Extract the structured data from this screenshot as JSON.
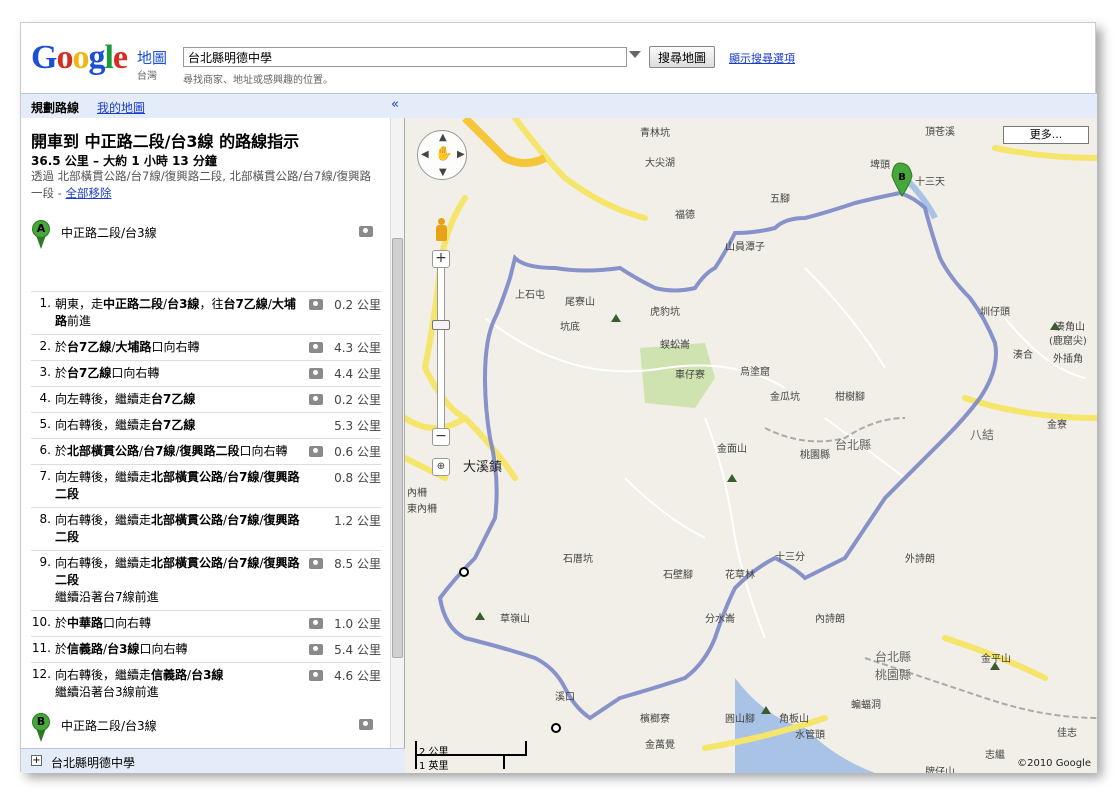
{
  "header": {
    "logo_text": "Google",
    "logo_sub": "地圖",
    "logo_region": "台灣",
    "search_value": "台北縣明德中學",
    "search_button": "搜尋地圖",
    "search_options": "顯示搜尋選項",
    "search_hint": "尋找商家、地址或感興趣的位置。"
  },
  "tabs": {
    "active": "規劃路線",
    "link": "我的地圖",
    "collapse_glyph": "«"
  },
  "directions": {
    "title": "開車到 中正路二段/台3線 的路線指示",
    "summary": "36.5 公里 – 大約 1 小時 13 分鐘",
    "via": "透過 北部橫貫公路/台7線/復興路二段, 北部橫貫公路/台7線/復興路一段 - ",
    "remove_all": "全部移除",
    "start": {
      "marker": "A",
      "label": "中正路二段/台3線"
    },
    "end": {
      "marker": "B",
      "label": "中正路二段/台3線"
    },
    "steps": [
      {
        "num": "1.",
        "text_html": "朝東，走<b>中正路二段</b>/<b>台3線</b>，往<b>台7乙線</b>/<b>大埔路</b>前進",
        "sub": "",
        "dist": "0.2 公里",
        "cam": true
      },
      {
        "num": "2.",
        "text_html": "於<b>台7乙線</b>/<b>大埔路</b>口向右轉",
        "sub": "",
        "dist": "4.3 公里",
        "cam": true
      },
      {
        "num": "3.",
        "text_html": "於<b>台7乙線</b>口向右轉",
        "sub": "",
        "dist": "4.4 公里",
        "cam": true
      },
      {
        "num": "4.",
        "text_html": "向左轉後，繼續走<b>台7乙線</b>",
        "sub": "",
        "dist": "0.2 公里",
        "cam": true
      },
      {
        "num": "5.",
        "text_html": "向右轉後，繼續走<b>台7乙線</b>",
        "sub": "",
        "dist": "5.3 公里",
        "cam": false
      },
      {
        "num": "6.",
        "text_html": "於<b>北部橫貫公路</b>/<b>台7線</b>/<b>復興路二段</b>口向右轉",
        "sub": "",
        "dist": "0.6 公里",
        "cam": true
      },
      {
        "num": "7.",
        "text_html": "向左轉後，繼續走<b>北部橫貫公路</b>/<b>台7線</b>/<b>復興路二段</b>",
        "sub": "",
        "dist": "0.8 公里",
        "cam": false
      },
      {
        "num": "8.",
        "text_html": "向右轉後，繼續走<b>北部橫貫公路</b>/<b>台7線</b>/<b>復興路二段</b>",
        "sub": "",
        "dist": "1.2 公里",
        "cam": false
      },
      {
        "num": "9.",
        "text_html": "向右轉後，繼續走<b>北部橫貫公路</b>/<b>台7線</b>/<b>復興路二段</b>",
        "sub": "繼續沿著台7線前進",
        "dist": "8.5 公里",
        "cam": true
      },
      {
        "num": "10.",
        "text_html": "於<b>中華路</b>口向右轉",
        "sub": "",
        "dist": "1.0 公里",
        "cam": true
      },
      {
        "num": "11.",
        "text_html": "於<b>信義路</b>/<b>台3線</b>口向右轉",
        "sub": "",
        "dist": "5.4 公里",
        "cam": true
      },
      {
        "num": "12.",
        "text_html": "向右轉後，繼續走<b>信義路</b>/<b>台3線</b>",
        "sub": "繼續沿著台3線前進",
        "dist": "4.6 公里",
        "cam": true
      }
    ]
  },
  "bottom_bar": {
    "label": "台北縣明德中學"
  },
  "map": {
    "more_button": "更多...",
    "copyright": "©2010 Google",
    "scale_km": "2 公里",
    "scale_mi": "1 英里",
    "labels": [
      "青林坑",
      "大尖湖",
      "頂苍溪",
      "埤頭",
      "十三天",
      "福德",
      "五腳",
      "山員潭子",
      "尾寮山",
      "上石屯",
      "虎豹坑",
      "坑底",
      "蜈蚣崙",
      "車仔寮",
      "烏塗窟",
      "金瓜坑",
      "柑樹腳",
      "圳仔頭",
      "湊角山",
      "(鹿窟尖)",
      "湊合",
      "外插角",
      "金面山",
      "桃園縣",
      "台北縣",
      "八結",
      "金寮",
      "大溪鎮",
      "內柵",
      "東內柵",
      "石厝坑",
      "石壁腳",
      "花草林",
      "十三分",
      "外詩朗",
      "草嶺山",
      "分水崙",
      "內詩朗",
      "台北縣",
      "桃園縣",
      "金平山",
      "蝙蝠洞",
      "角板山",
      "溪口",
      "檳榔寮",
      "金萬覺",
      "圓山腳",
      "水管頭",
      "牌仔山",
      "志繼",
      "佳志"
    ]
  }
}
